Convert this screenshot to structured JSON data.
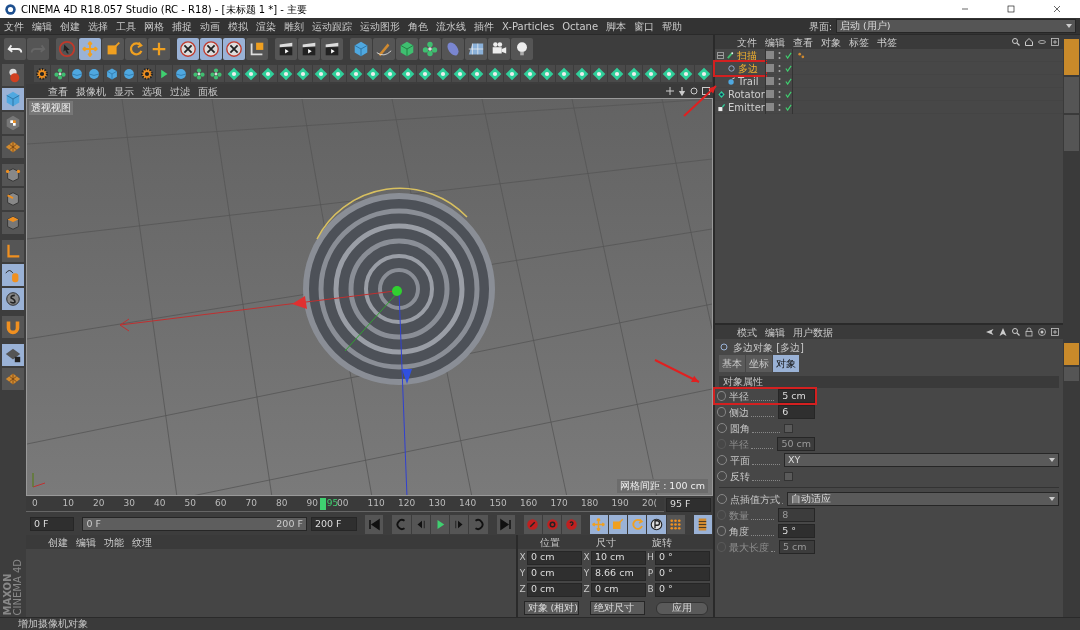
{
  "window": {
    "title": "CINEMA 4D R18.057 Studio (RC - R18) - [未标题 1 *] - 主要"
  },
  "menu_bar": [
    "文件",
    "编辑",
    "创建",
    "选择",
    "工具",
    "网格",
    "捕捉",
    "动画",
    "模拟",
    "渲染",
    "雕刻",
    "运动跟踪",
    "运动图形",
    "角色",
    "流水线",
    "插件",
    "X-Particles",
    "Octane",
    "脚本",
    "窗口",
    "帮助"
  ],
  "layout_selector": {
    "label": "界面:",
    "value": "启动 (用户)"
  },
  "viewport": {
    "menu": [
      "查看",
      "摄像机",
      "显示",
      "选项",
      "过滤",
      "面板"
    ],
    "view_name": "透视视图",
    "grid_spacing": "网格间距 : 100 cm"
  },
  "timeline": {
    "ticks": [
      "0",
      "10",
      "20",
      "30",
      "40",
      "50",
      "60",
      "70",
      "80",
      "90",
      "00",
      "110",
      "120",
      "130",
      "140",
      "150",
      "160",
      "170",
      "180",
      "190",
      "20("
    ],
    "current": "95",
    "level": 0.475,
    "frame_field": "95 F"
  },
  "transport": {
    "start_field": "0 F",
    "range_start": "0 F",
    "range_end": "200 F",
    "level": 1,
    "end_field": "200 F"
  },
  "material_manager": {
    "menu": [
      "创建",
      "编辑",
      "功能",
      "纹理"
    ]
  },
  "logo": {
    "brand": "MAXON",
    "product": "CINEMA 4D"
  },
  "coordinates": {
    "columns": [
      "位置",
      "尺寸",
      "旋转"
    ],
    "rows": [
      [
        {
          "axis": "X",
          "value": "0 cm"
        },
        {
          "axis": "X",
          "value": "10 cm"
        },
        {
          "axis": "H",
          "value": "0 °"
        }
      ],
      [
        {
          "axis": "Y",
          "value": "0 cm"
        },
        {
          "axis": "Y",
          "value": "8.66 cm"
        },
        {
          "axis": "P",
          "value": "0 °"
        }
      ],
      [
        {
          "axis": "Z",
          "value": "0 cm"
        },
        {
          "axis": "Z",
          "value": "0 cm"
        },
        {
          "axis": "B",
          "value": "0 °"
        }
      ]
    ],
    "mode": "对象 (相对)",
    "size_mode": "绝对尺寸",
    "apply": "应用"
  },
  "status_bar": "增加摄像机对象",
  "object_manager": {
    "menu": [
      "文件",
      "编辑",
      "查看",
      "对象",
      "标签",
      "书签"
    ],
    "objects": [
      {
        "name": "扫描",
        "selected": true,
        "expanded": true,
        "annotated": false,
        "children": [
          {
            "name": "多边",
            "selected": true,
            "annotated": true
          },
          {
            "name": "Trail",
            "selected": false,
            "annotated": false
          }
        ]
      },
      {
        "name": "Rotator",
        "selected": false,
        "annotated": false
      },
      {
        "name": "Emitter",
        "selected": false,
        "annotated": false
      }
    ]
  },
  "attributes": {
    "menu": [
      "模式",
      "编辑",
      "用户数据"
    ],
    "title": "多边对象 [多边]",
    "tabs": [
      {
        "label": "基本",
        "selected": false
      },
      {
        "label": "坐标",
        "selected": false
      },
      {
        "label": "对象",
        "selected": true
      }
    ],
    "section": "对象属性",
    "fields": [
      {
        "kind": "number",
        "label": "半径",
        "value": "5 cm",
        "disabled": false,
        "annotated": true
      },
      {
        "kind": "number",
        "label": "侧边",
        "value": "6",
        "disabled": false,
        "annotated": false
      },
      {
        "kind": "checkbox",
        "label": "圆角",
        "checked": false,
        "disabled": false,
        "annotated": false
      },
      {
        "kind": "number",
        "label": "半径",
        "value": "50 cm",
        "disabled": true,
        "annotated": false
      },
      {
        "kind": "dropdown",
        "label": "平面",
        "value": "XY",
        "disabled": false,
        "annotated": false
      },
      {
        "kind": "checkbox",
        "label": "反转",
        "checked": false,
        "disabled": false,
        "annotated": false
      },
      {
        "kind": "separator"
      },
      {
        "kind": "dropdown",
        "label": "点插值方式",
        "value": "自动适应",
        "disabled": false,
        "annotated": false
      },
      {
        "kind": "number",
        "label": "数量",
        "value": "8",
        "disabled": true,
        "annotated": false
      },
      {
        "kind": "number",
        "label": "角度",
        "value": "5 °",
        "disabled": false,
        "annotated": false
      },
      {
        "kind": "number",
        "label": "最大长度",
        "value": "5 cm",
        "disabled": true,
        "annotated": false
      }
    ]
  }
}
